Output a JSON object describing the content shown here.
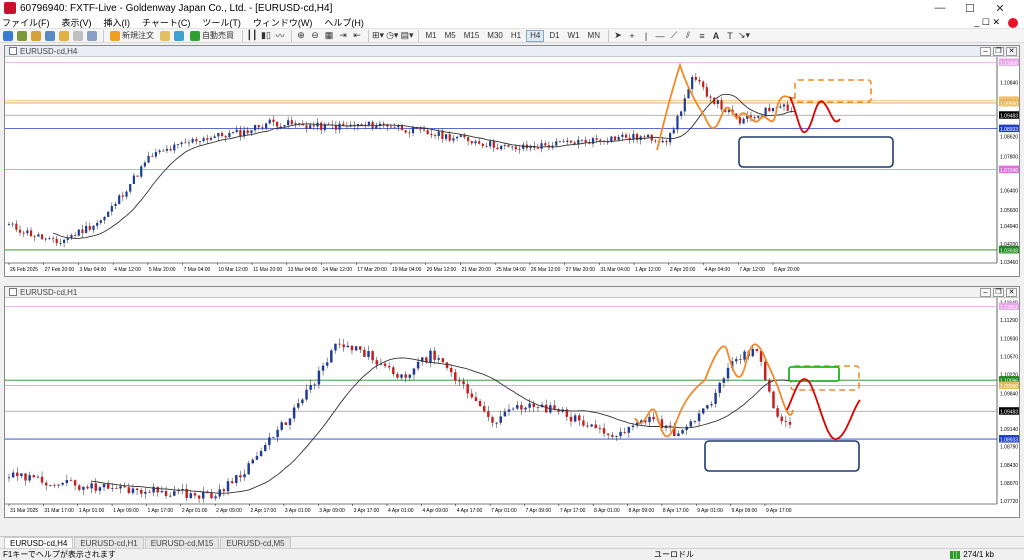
{
  "window": {
    "title": "60796940: FXTF-Live - Goldenway Japan Co., Ltd. - [EURUSD-cd,H4]"
  },
  "menu": [
    "ファイル(F)",
    "表示(V)",
    "挿入(I)",
    "チャート(C)",
    "ツール(T)",
    "ウィンドウ(W)",
    "ヘルプ(H)"
  ],
  "toolbar": {
    "new_order": "新規注文",
    "auto_trade": "自動売買",
    "timeframes": [
      "M1",
      "M5",
      "M15",
      "M30",
      "H1",
      "H4",
      "D1",
      "W1",
      "MN"
    ]
  },
  "chart_top": {
    "title": "EURUSD-cd,H4",
    "price_labels": [
      {
        "p": 1.1166,
        "text": "1.11660",
        "bg": "#e9a6e9"
      },
      {
        "p": 1.1084,
        "text": "1.10840",
        "bg": ""
      },
      {
        "p": 1.10096,
        "text": "1.10096",
        "bg": "#f5c06b"
      },
      {
        "p": 1.0999,
        "text": "1.09990",
        "bg": "#e5b95a"
      },
      {
        "p": 1.09483,
        "text": "1.09483",
        "bg": "#000000"
      },
      {
        "p": 1.08933,
        "text": "1.08933",
        "bg": "#1e3fc8"
      },
      {
        "p": 1.0862,
        "text": "1.08620",
        "bg": ""
      },
      {
        "p": 1.078,
        "text": "1.07800",
        "bg": ""
      },
      {
        "p": 1.07246,
        "text": "1.07246",
        "bg": "#e070e0"
      },
      {
        "p": 1.064,
        "text": "1.06400",
        "bg": ""
      },
      {
        "p": 1.056,
        "text": "1.05600",
        "bg": ""
      },
      {
        "p": 1.0494,
        "text": "1.04940",
        "bg": ""
      },
      {
        "p": 1.042,
        "text": "1.04200",
        "bg": ""
      },
      {
        "p": 1.03938,
        "text": "1.03938",
        "bg": "#1c8a1c"
      },
      {
        "p": 1.0346,
        "text": "1.03460",
        "bg": ""
      }
    ],
    "time_labels": [
      "26 Feb 2025",
      "27 Feb 20:00",
      "3 Mar 04:00",
      "4 Mar 12:00",
      "5 Mar 20:00",
      "7 Mar 04:00",
      "10 Mar 12:00",
      "11 Mar 20:00",
      "13 Mar 04:00",
      "14 Mar 12:00",
      "17 Mar 20:00",
      "19 Mar 04:00",
      "20 Mar 12:00",
      "21 Mar 20:00",
      "25 Mar 04:00",
      "26 Mar 12:00",
      "27 Mar 20:00",
      "31 Mar 04:00",
      "1 Apr 12:00",
      "2 Apr 20:00",
      "4 Apr 04:00",
      "7 Apr 12:00",
      "8 Apr 20:00"
    ]
  },
  "chart_bottom": {
    "title": "EURUSD-cd,H1",
    "price_labels": [
      {
        "p": 1.1164,
        "text": "1.11640",
        "bg": ""
      },
      {
        "p": 1.11552,
        "text": "1.11552",
        "bg": "#e9a6e9"
      },
      {
        "p": 1.1129,
        "text": "1.11290",
        "bg": ""
      },
      {
        "p": 1.1093,
        "text": "1.10930",
        "bg": ""
      },
      {
        "p": 1.1057,
        "text": "1.10570",
        "bg": ""
      },
      {
        "p": 1.1022,
        "text": "1.10220",
        "bg": ""
      },
      {
        "p": 1.10096,
        "text": "1.10096",
        "bg": "#1c8a1c"
      },
      {
        "p": 1.0999,
        "text": "1.09990",
        "bg": "#e5b95a"
      },
      {
        "p": 1.0984,
        "text": "1.09840",
        "bg": ""
      },
      {
        "p": 1.09483,
        "text": "1.09483",
        "bg": "#000000"
      },
      {
        "p": 1.0914,
        "text": "1.09140",
        "bg": ""
      },
      {
        "p": 1.08933,
        "text": "1.08933",
        "bg": "#1e3fc8"
      },
      {
        "p": 1.0879,
        "text": "1.08790",
        "bg": ""
      },
      {
        "p": 1.0843,
        "text": "1.08430",
        "bg": ""
      },
      {
        "p": 1.0807,
        "text": "1.08070",
        "bg": ""
      },
      {
        "p": 1.0772,
        "text": "1.07720",
        "bg": ""
      }
    ],
    "time_labels": [
      "31 Mar 2025",
      "31 Mar 17:00",
      "1 Apr 01:00",
      "1 Apr 09:00",
      "1 Apr 17:00",
      "2 Apr 01:00",
      "2 Apr 09:00",
      "2 Apr 17:00",
      "3 Apr 01:00",
      "3 Apr 09:00",
      "3 Apr 17:00",
      "4 Apr 01:00",
      "4 Apr 09:00",
      "4 Apr 17:00",
      "7 Apr 01:00",
      "7 Apr 09:00",
      "7 Apr 17:00",
      "8 Apr 01:00",
      "8 Apr 09:00",
      "8 Apr 17:00",
      "9 Apr 01:00",
      "9 Apr 09:00",
      "9 Apr 17:00"
    ]
  },
  "tabs": [
    "EURUSD-cd,H4",
    "EURUSD-cd,H1",
    "EURUSD-cd,M15",
    "EURUSD-cd,M5"
  ],
  "status": {
    "help": "F1キーでヘルプが表示されます",
    "profile": "ユーロドル",
    "traffic": "274/1 kb"
  },
  "colors": {
    "bull": "#1e3c96",
    "bear": "#c81e1e",
    "ma": "#333333",
    "orange": "#f08a28",
    "red_path": "#e00000",
    "navy_box": "#1e3c6e",
    "green_box": "#1eb41e"
  }
}
